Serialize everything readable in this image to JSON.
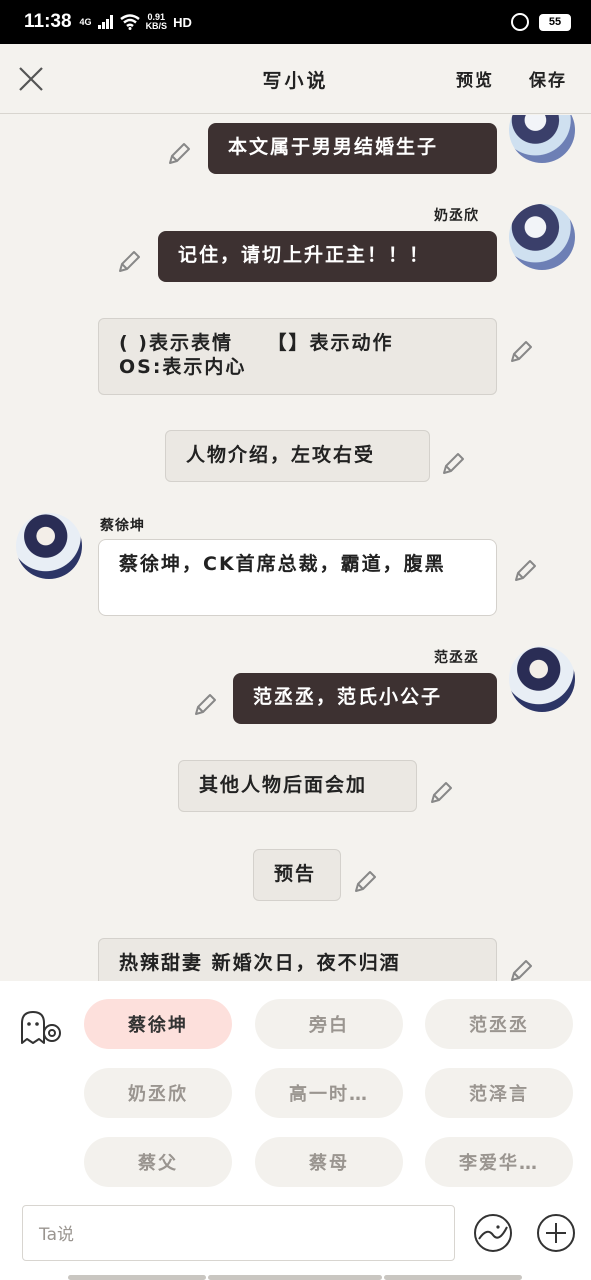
{
  "status_bar": {
    "time": "11:38",
    "net": "4G",
    "speed_value": "0.91",
    "speed_unit": "KB/S",
    "hd": "HD",
    "battery": "55"
  },
  "header": {
    "title": "写小说",
    "preview_label": "预览",
    "save_label": "保存"
  },
  "messages": [
    {
      "text": "本文属于男男结婚生子"
    },
    {
      "name": "奶丞欣",
      "text": "记住，请切上升正主！！！"
    },
    {
      "text": "( )表示表情    【】表示动作\nOS:表示内心"
    },
    {
      "text": "人物介绍，左攻右受"
    },
    {
      "name": "蔡徐坤",
      "text": "蔡徐坤，CK首席总裁，霸道，腹黑"
    },
    {
      "name": "范丞丞",
      "text": "范丞丞，范氏小公子"
    },
    {
      "text": "其他人物后面会加"
    },
    {
      "text": "预告"
    },
    {
      "text": "热辣甜妻 新婚次日，夜不归酒"
    }
  ],
  "roles": [
    "蔡徐坤",
    "旁白",
    "范丞丞",
    "奶丞欣",
    "高一时…",
    "范泽言",
    "蔡父",
    "蔡母",
    "李爱华…"
  ],
  "input": {
    "placeholder": "Ta说"
  }
}
